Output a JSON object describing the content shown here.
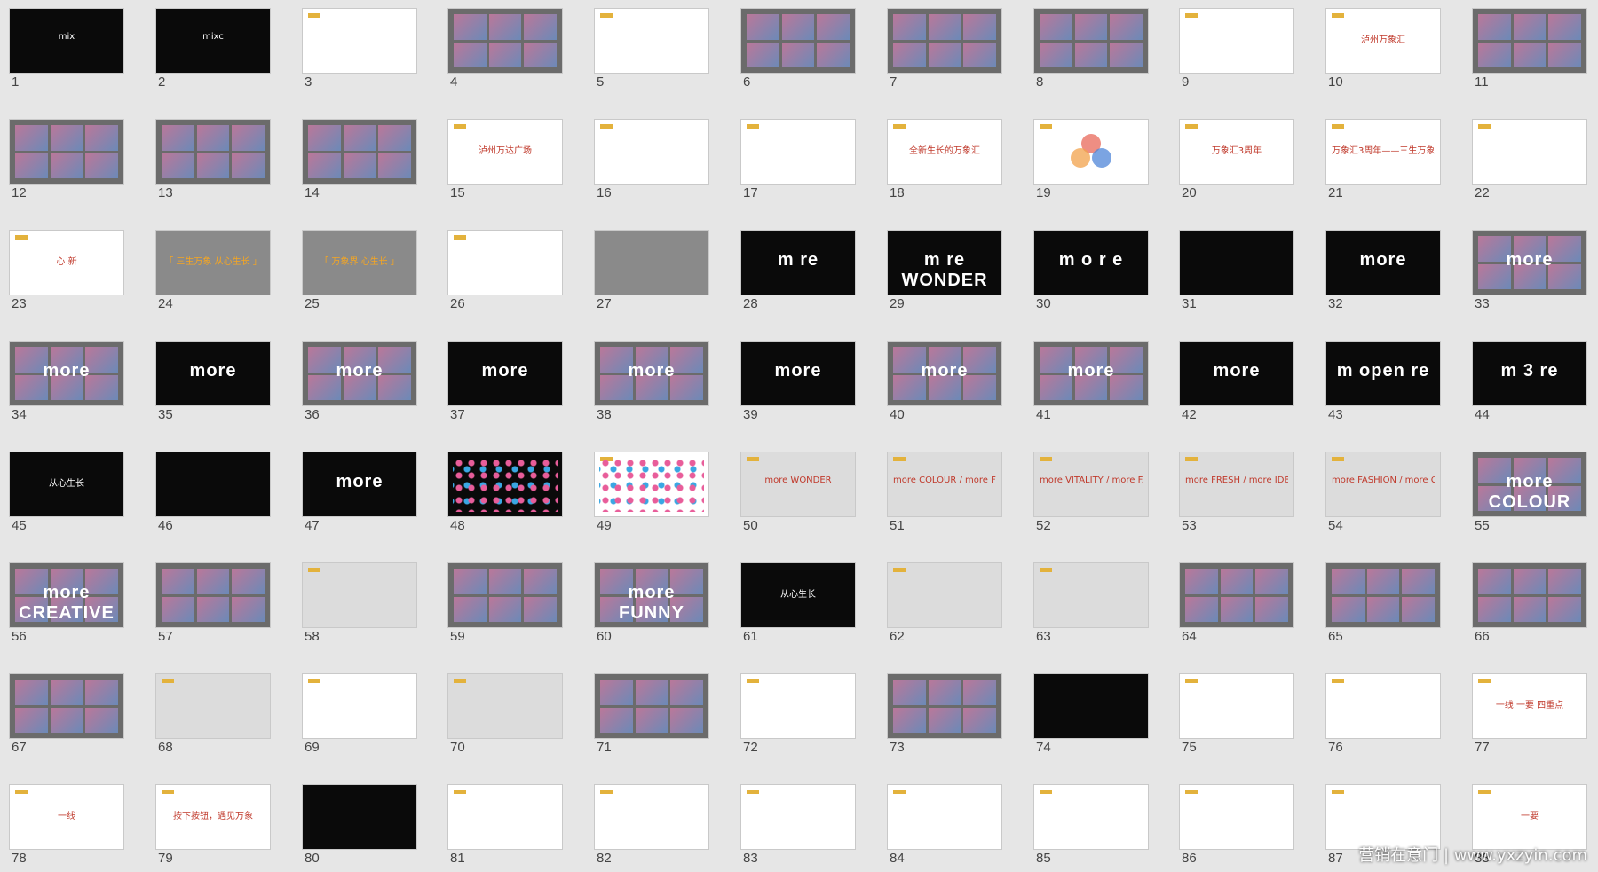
{
  "app": {
    "watermark": "营销在意门 | www.yxzyin.com"
  },
  "slides": [
    {
      "n": "1",
      "style": "black",
      "text": "mix"
    },
    {
      "n": "2",
      "style": "black",
      "text": "mixc"
    },
    {
      "n": "3",
      "style": "white",
      "text": ""
    },
    {
      "n": "4",
      "style": "photo",
      "text": ""
    },
    {
      "n": "5",
      "style": "white",
      "text": ""
    },
    {
      "n": "6",
      "style": "photo",
      "text": ""
    },
    {
      "n": "7",
      "style": "photo",
      "text": ""
    },
    {
      "n": "8",
      "style": "photo",
      "text": ""
    },
    {
      "n": "9",
      "style": "white",
      "text": ""
    },
    {
      "n": "10",
      "style": "white",
      "text": "泸州万象汇"
    },
    {
      "n": "11",
      "style": "photo",
      "text": ""
    },
    {
      "n": "12",
      "style": "photo",
      "text": ""
    },
    {
      "n": "13",
      "style": "photo",
      "text": ""
    },
    {
      "n": "14",
      "style": "photo",
      "text": ""
    },
    {
      "n": "15",
      "style": "white",
      "text": "泸州万达广场"
    },
    {
      "n": "16",
      "style": "white",
      "text": ""
    },
    {
      "n": "17",
      "style": "white",
      "text": ""
    },
    {
      "n": "18",
      "style": "white",
      "text": "全新生长的万象汇"
    },
    {
      "n": "19",
      "style": "white",
      "text": ""
    },
    {
      "n": "20",
      "style": "white",
      "text": "万象汇3周年"
    },
    {
      "n": "21",
      "style": "white",
      "text": "万象汇3周年——三生万象"
    },
    {
      "n": "22",
      "style": "white",
      "text": ""
    },
    {
      "n": "23",
      "style": "white",
      "text": "心  新"
    },
    {
      "n": "24",
      "style": "gray",
      "text": "「 三生万象 从心生长 」"
    },
    {
      "n": "25",
      "style": "gray",
      "text": "「 万象界 心生长 」"
    },
    {
      "n": "26",
      "style": "white",
      "text": ""
    },
    {
      "n": "27",
      "style": "gray",
      "text": ""
    },
    {
      "n": "28",
      "style": "black",
      "text": "m   re"
    },
    {
      "n": "29",
      "style": "black",
      "text": "m re WONDER"
    },
    {
      "n": "30",
      "style": "black",
      "text": "m o r e"
    },
    {
      "n": "31",
      "style": "black",
      "text": ""
    },
    {
      "n": "32",
      "style": "black",
      "text": "more"
    },
    {
      "n": "33",
      "style": "photo",
      "text": "more"
    },
    {
      "n": "34",
      "style": "photo",
      "text": "more"
    },
    {
      "n": "35",
      "style": "black",
      "text": "more"
    },
    {
      "n": "36",
      "style": "photo",
      "text": "more"
    },
    {
      "n": "37",
      "style": "black",
      "text": "more"
    },
    {
      "n": "38",
      "style": "photo",
      "text": "more"
    },
    {
      "n": "39",
      "style": "black",
      "text": "more"
    },
    {
      "n": "40",
      "style": "photo",
      "text": "more"
    },
    {
      "n": "41",
      "style": "photo",
      "text": "more"
    },
    {
      "n": "42",
      "style": "black",
      "text": "more"
    },
    {
      "n": "43",
      "style": "black",
      "text": "m open re"
    },
    {
      "n": "44",
      "style": "black",
      "text": "m 3 re"
    },
    {
      "n": "45",
      "style": "black",
      "text": "从心生长"
    },
    {
      "n": "46",
      "style": "black",
      "text": ""
    },
    {
      "n": "47",
      "style": "black",
      "text": "more"
    },
    {
      "n": "48",
      "style": "black",
      "text": ""
    },
    {
      "n": "49",
      "style": "white",
      "text": ""
    },
    {
      "n": "50",
      "style": "lightgray",
      "text": "more WONDER"
    },
    {
      "n": "51",
      "style": "lightgray",
      "text": "more COLOUR / more FUNNY"
    },
    {
      "n": "52",
      "style": "lightgray",
      "text": "more VITALITY / more FANTSY"
    },
    {
      "n": "53",
      "style": "lightgray",
      "text": "more FRESH / more IDEA"
    },
    {
      "n": "54",
      "style": "lightgray",
      "text": "more FASHION / more CREATIVE"
    },
    {
      "n": "55",
      "style": "photo",
      "text": "more COLOUR"
    },
    {
      "n": "56",
      "style": "photo",
      "text": "more CREATIVE"
    },
    {
      "n": "57",
      "style": "photo",
      "text": ""
    },
    {
      "n": "58",
      "style": "lightgray",
      "text": ""
    },
    {
      "n": "59",
      "style": "photo",
      "text": ""
    },
    {
      "n": "60",
      "style": "photo",
      "text": "more FUNNY"
    },
    {
      "n": "61",
      "style": "black",
      "text": "从心生长"
    },
    {
      "n": "62",
      "style": "lightgray",
      "text": ""
    },
    {
      "n": "63",
      "style": "lightgray",
      "text": ""
    },
    {
      "n": "64",
      "style": "photo",
      "text": ""
    },
    {
      "n": "65",
      "style": "photo",
      "text": ""
    },
    {
      "n": "66",
      "style": "photo",
      "text": ""
    },
    {
      "n": "67",
      "style": "photo",
      "text": ""
    },
    {
      "n": "68",
      "style": "lightgray",
      "text": ""
    },
    {
      "n": "69",
      "style": "white",
      "text": ""
    },
    {
      "n": "70",
      "style": "lightgray",
      "text": ""
    },
    {
      "n": "71",
      "style": "photo",
      "text": ""
    },
    {
      "n": "72",
      "style": "white",
      "text": ""
    },
    {
      "n": "73",
      "style": "photo",
      "text": ""
    },
    {
      "n": "74",
      "style": "black",
      "text": ""
    },
    {
      "n": "75",
      "style": "white",
      "text": ""
    },
    {
      "n": "76",
      "style": "white",
      "text": ""
    },
    {
      "n": "77",
      "style": "white",
      "text": "一线 一要 四重点"
    },
    {
      "n": "78",
      "style": "white",
      "text": "一线"
    },
    {
      "n": "79",
      "style": "white",
      "text": "按下按钮，遇见万象"
    },
    {
      "n": "80",
      "style": "black",
      "text": ""
    },
    {
      "n": "81",
      "style": "white",
      "text": ""
    },
    {
      "n": "82",
      "style": "white",
      "text": ""
    },
    {
      "n": "83",
      "style": "white",
      "text": ""
    },
    {
      "n": "84",
      "style": "white",
      "text": ""
    },
    {
      "n": "85",
      "style": "white",
      "text": ""
    },
    {
      "n": "86",
      "style": "white",
      "text": ""
    },
    {
      "n": "87",
      "style": "white",
      "text": ""
    },
    {
      "n": "88",
      "style": "white",
      "text": "一要"
    }
  ]
}
